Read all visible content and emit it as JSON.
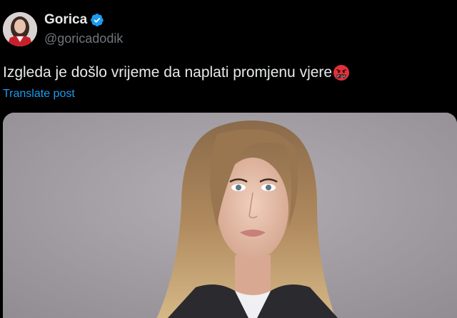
{
  "post": {
    "author": {
      "display_name": "Gorica",
      "handle": "@goricadodik",
      "verified": true
    },
    "text": "Izgleda je došlo vrijeme da naplati promjenu vjere",
    "emoji": "face-with-symbols-on-mouth",
    "translate_label": "Translate post"
  },
  "colors": {
    "background": "#000000",
    "text_primary": "#e7e9ea",
    "text_secondary": "#71767b",
    "link": "#1d9bf0",
    "verified_badge": "#1d9bf0",
    "emoji_red": "#e0323c"
  },
  "icons": {
    "verified": "verified-badge-icon",
    "emoji": "angry-emoji-icon"
  }
}
